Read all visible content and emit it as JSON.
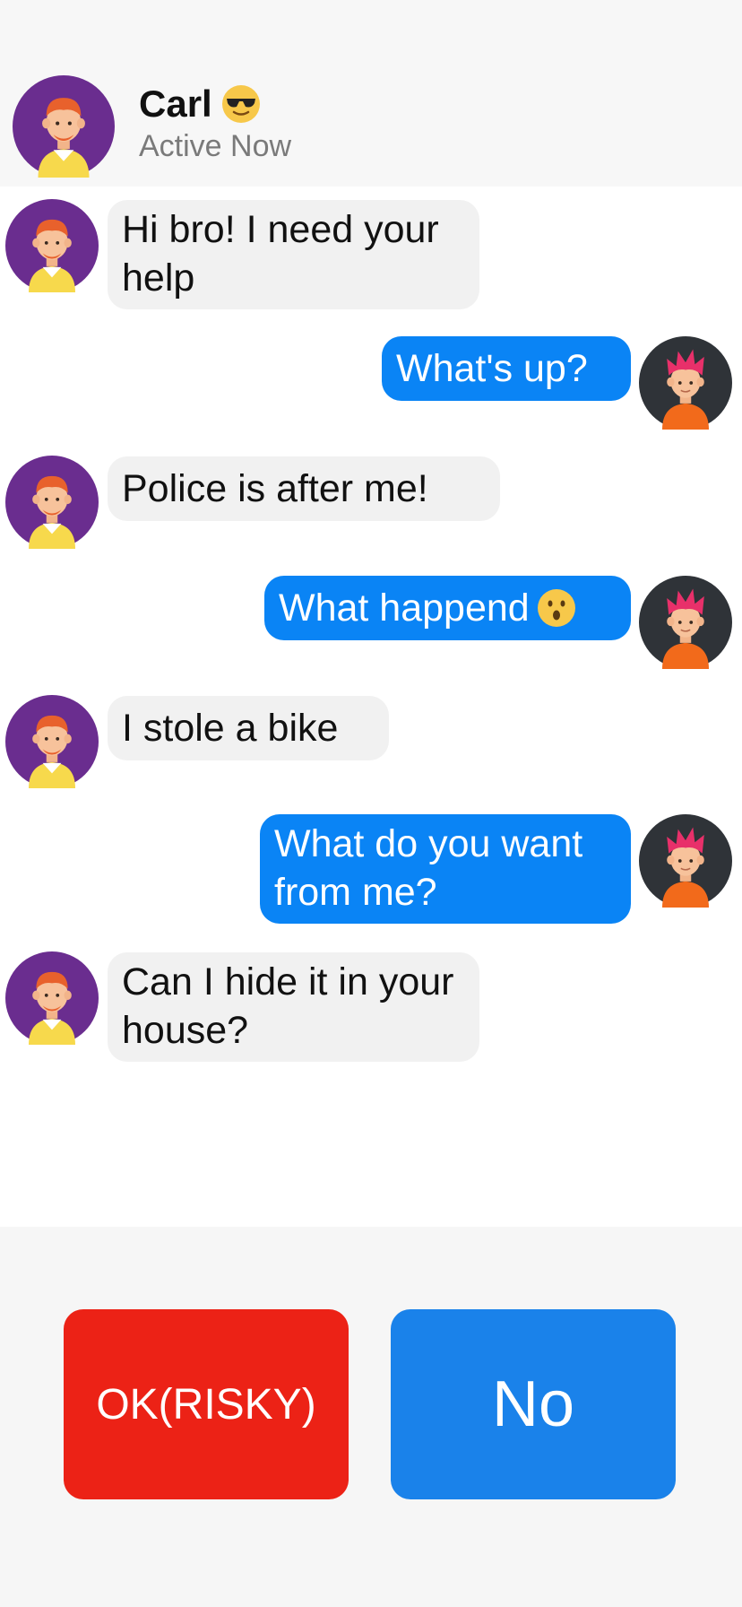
{
  "contact": {
    "name": "Carl",
    "name_emoji": "sunglasses-emoji",
    "status": "Active Now"
  },
  "messages": [
    {
      "from": "them",
      "text": "Hi bro! I need your help"
    },
    {
      "from": "me",
      "text": "What's up?"
    },
    {
      "from": "them",
      "text": "Police is after me!"
    },
    {
      "from": "me",
      "text": "What happend",
      "emoji": "surprised-emoji"
    },
    {
      "from": "them",
      "text": "I stole a bike"
    },
    {
      "from": "me",
      "text": "What do you want from me?"
    },
    {
      "from": "them",
      "text": "Can I hide it in your house?"
    }
  ],
  "choices": {
    "ok_label": "OK(RISKY)",
    "no_label": "No"
  },
  "colors": {
    "incoming_bubble": "#f1f1f1",
    "outgoing_bubble": "#0a84f5",
    "ok_button": "#ec2216",
    "no_button": "#1a82ea",
    "header_bg": "#f7f7f7"
  }
}
